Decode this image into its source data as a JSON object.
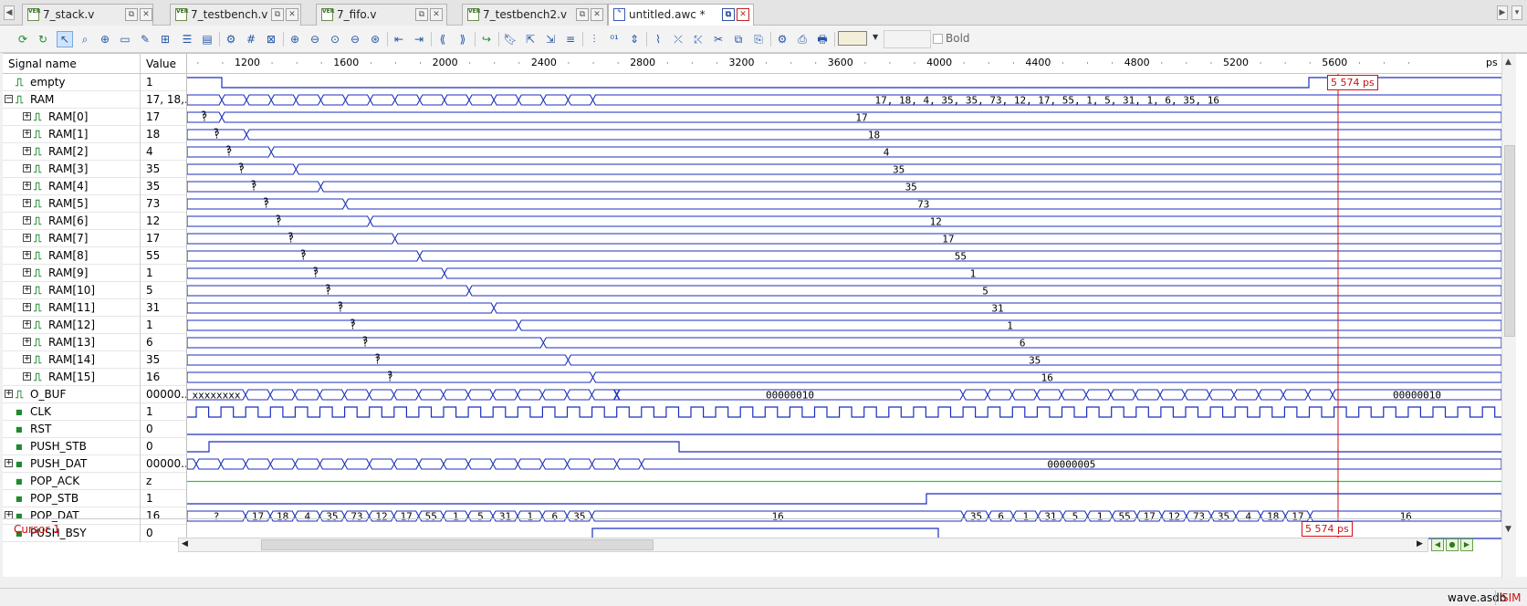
{
  "tabs": [
    {
      "label": "7_stack.v",
      "icon": "verilog-file-icon"
    },
    {
      "label": "7_testbench.v",
      "icon": "verilog-file-icon"
    },
    {
      "label": "7_fifo.v",
      "icon": "verilog-file-icon"
    },
    {
      "label": "7_testbench2.v",
      "icon": "verilog-file-icon"
    },
    {
      "label": "untitled.awc *",
      "icon": "waveform-file-icon",
      "active": true
    }
  ],
  "toolbar": {
    "bold_label": "Bold",
    "highlight_color": "#f2eed8"
  },
  "headers": {
    "name": "Signal name",
    "value": "Value"
  },
  "ruler": {
    "labels": [
      "1200",
      "1600",
      "2000",
      "2400",
      "2800",
      "3200",
      "3600",
      "4000",
      "4400",
      "4800",
      "5200",
      "5600"
    ],
    "unit": "ps"
  },
  "signals": [
    {
      "name": "empty",
      "value": "1",
      "kind": "wire",
      "expander": ""
    },
    {
      "name": "RAM",
      "value": "17, 18,...",
      "kind": "wire",
      "expander": "−"
    },
    {
      "name": "RAM[0]",
      "value": "17",
      "kind": "wire",
      "expander": "+"
    },
    {
      "name": "RAM[1]",
      "value": "18",
      "kind": "wire",
      "expander": "+"
    },
    {
      "name": "RAM[2]",
      "value": "4",
      "kind": "wire",
      "expander": "+"
    },
    {
      "name": "RAM[3]",
      "value": "35",
      "kind": "wire",
      "expander": "+"
    },
    {
      "name": "RAM[4]",
      "value": "35",
      "kind": "wire",
      "expander": "+"
    },
    {
      "name": "RAM[5]",
      "value": "73",
      "kind": "wire",
      "expander": "+"
    },
    {
      "name": "RAM[6]",
      "value": "12",
      "kind": "wire",
      "expander": "+"
    },
    {
      "name": "RAM[7]",
      "value": "17",
      "kind": "wire",
      "expander": "+"
    },
    {
      "name": "RAM[8]",
      "value": "55",
      "kind": "wire",
      "expander": "+"
    },
    {
      "name": "RAM[9]",
      "value": "1",
      "kind": "wire",
      "expander": "+"
    },
    {
      "name": "RAM[10]",
      "value": "5",
      "kind": "wire",
      "expander": "+"
    },
    {
      "name": "RAM[11]",
      "value": "31",
      "kind": "wire",
      "expander": "+"
    },
    {
      "name": "RAM[12]",
      "value": "1",
      "kind": "wire",
      "expander": "+"
    },
    {
      "name": "RAM[13]",
      "value": "6",
      "kind": "wire",
      "expander": "+"
    },
    {
      "name": "RAM[14]",
      "value": "35",
      "kind": "wire",
      "expander": "+"
    },
    {
      "name": "RAM[15]",
      "value": "16",
      "kind": "wire",
      "expander": "+"
    },
    {
      "name": "O_BUF",
      "value": "00000...",
      "kind": "wire",
      "expander": "+"
    },
    {
      "name": "CLK",
      "value": "1",
      "kind": "port",
      "expander": ""
    },
    {
      "name": "RST",
      "value": "0",
      "kind": "port",
      "expander": ""
    },
    {
      "name": "PUSH_STB",
      "value": "0",
      "kind": "port",
      "expander": ""
    },
    {
      "name": "PUSH_DAT",
      "value": "00000...",
      "kind": "port",
      "expander": "+"
    },
    {
      "name": "POP_ACK",
      "value": "z",
      "kind": "port",
      "expander": ""
    },
    {
      "name": "POP_STB",
      "value": "1",
      "kind": "port",
      "expander": ""
    },
    {
      "name": "POP_DAT",
      "value": "16",
      "kind": "port",
      "expander": "+"
    },
    {
      "name": "PUSH_BSY",
      "value": "0",
      "kind": "port",
      "expander": ""
    }
  ],
  "wave_text": {
    "ram_bus": "17, 18, 4, 35, 35, 73, 12, 17, 55, 1, 5, 31, 1, 6, 35, 16",
    "unknown": "?",
    "obuf_x": "xxxxxxxx",
    "obuf_value": "00000010",
    "push_dat_value": "00000005",
    "pop_dat_first": [
      "?",
      "17",
      "18",
      "4",
      "35",
      "73",
      "12",
      "17",
      "55",
      "1",
      "5",
      "31",
      "1",
      "6",
      "35"
    ],
    "pop_dat_long": "16",
    "pop_dat_second": [
      "35",
      "6",
      "1",
      "31",
      "5",
      "1",
      "55",
      "17",
      "12",
      "73",
      "35",
      "4",
      "18",
      "17"
    ],
    "pop_dat_last": "16"
  },
  "cursor": {
    "label": "Cursor 1",
    "time": "5 574 ps"
  },
  "status": {
    "db": "wave.asdb",
    "mode": "SIM"
  },
  "colors": {
    "wave": "#1a2fbf",
    "cursor": "#d01010",
    "hiz": "#2ec82e"
  }
}
